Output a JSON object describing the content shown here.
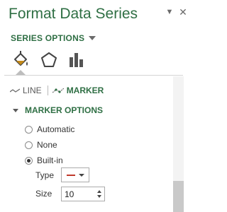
{
  "pane": {
    "title": "Format Data Series",
    "menu_glyph": "▼",
    "close_glyph": "✕"
  },
  "series_options": {
    "label": "SERIES OPTIONS"
  },
  "category_icons": [
    "fill-line-icon",
    "effects-icon",
    "series-options-icon"
  ],
  "tabs": {
    "line_label": "LINE",
    "marker_label": "MARKER",
    "active": "marker"
  },
  "marker_options": {
    "title": "MARKER OPTIONS",
    "radios": [
      {
        "label": "Automatic",
        "checked": false
      },
      {
        "label": "None",
        "checked": false
      },
      {
        "label": "Built-in",
        "checked": true
      }
    ],
    "type": {
      "label": "Type"
    },
    "size": {
      "label": "Size",
      "value": "10"
    }
  },
  "colors": {
    "accent": "#2f6f44",
    "marker_color": "#c0392b"
  }
}
